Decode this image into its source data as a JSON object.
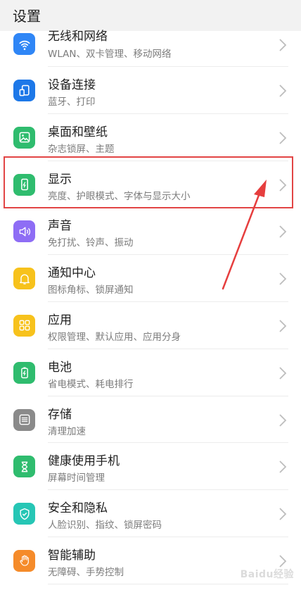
{
  "header": {
    "title": "设置"
  },
  "items": [
    {
      "title": "无线和网络",
      "subtitle": "WLAN、双卡管理、移动网络",
      "color": "#2f86f6",
      "icon": "wifi-icon"
    },
    {
      "title": "设备连接",
      "subtitle": "蓝牙、打印",
      "color": "#1d78e8",
      "icon": "device-connection-icon"
    },
    {
      "title": "桌面和壁纸",
      "subtitle": "杂志锁屏、主题",
      "color": "#2fbc6e",
      "icon": "wallpaper-icon"
    },
    {
      "title": "显示",
      "subtitle": "亮度、护眼模式、字体与显示大小",
      "color": "#2fbc6e",
      "icon": "display-icon"
    },
    {
      "title": "声音",
      "subtitle": "免打扰、铃声、振动",
      "color": "#8e6df5",
      "icon": "sound-icon"
    },
    {
      "title": "通知中心",
      "subtitle": "图标角标、锁屏通知",
      "color": "#f7c21c",
      "icon": "bell-icon"
    },
    {
      "title": "应用",
      "subtitle": "权限管理、默认应用、应用分身",
      "color": "#f7c21c",
      "icon": "apps-icon"
    },
    {
      "title": "电池",
      "subtitle": "省电模式、耗电排行",
      "color": "#2fbc6e",
      "icon": "battery-icon"
    },
    {
      "title": "存储",
      "subtitle": "清理加速",
      "color": "#8a8a8a",
      "icon": "storage-icon"
    },
    {
      "title": "健康使用手机",
      "subtitle": "屏幕时间管理",
      "color": "#2fbc6e",
      "icon": "hourglass-icon"
    },
    {
      "title": "安全和隐私",
      "subtitle": "人脸识别、指纹、锁屏密码",
      "color": "#26c6b5",
      "icon": "shield-icon"
    },
    {
      "title": "智能辅助",
      "subtitle": "无障碍、手势控制",
      "color": "#f58b2a",
      "icon": "hand-icon"
    }
  ],
  "watermark": "Baidu经验"
}
